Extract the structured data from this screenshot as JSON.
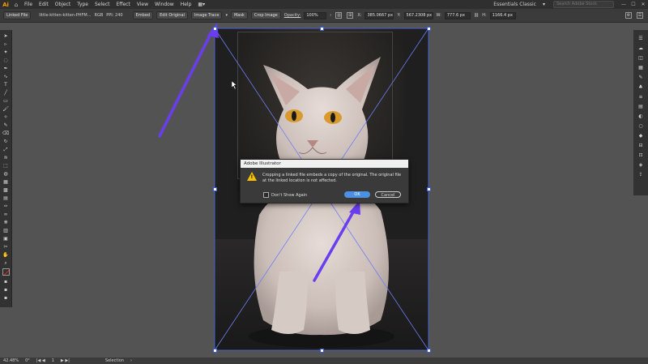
{
  "app": {
    "logo": "Ai",
    "workspace": "Essentials Classic",
    "search_placeholder": "Search Adobe Stock"
  },
  "menus": [
    "File",
    "Edit",
    "Object",
    "Type",
    "Select",
    "Effect",
    "View",
    "Window",
    "Help"
  ],
  "control_bar": {
    "linked_file": "Linked File",
    "file_name": "little-kitten-kitten-PHFM...",
    "color_mode": "RGB",
    "ppi": "PPI: 240",
    "embed": "Embed",
    "edit_original": "Edit Original",
    "image_trace": "Image Trace",
    "mask": "Mask",
    "crop_image": "Crop Image",
    "opacity_label": "Opacity:",
    "opacity_value": "100%",
    "x_label": "X:",
    "x_value": "385.0667 px",
    "y_label": "Y:",
    "y_value": "567.2308 px",
    "w_label": "W:",
    "w_value": "777.6 px",
    "h_label": "H:",
    "h_value": "1166.4 px"
  },
  "dialog": {
    "title": "Adobe Illustrator",
    "message": "Cropping a linked file embeds a copy of the original. The original file at the linked location is not affected.",
    "checkbox_label": "Don't Show Again",
    "ok_label": "OK",
    "cancel_label": "Cancel"
  },
  "status_bar": {
    "zoom": "42.48%",
    "angle": "0°",
    "page": "1",
    "tool": "Selection"
  },
  "colors": {
    "accent_arrow": "#6a3df0",
    "selection_blue": "#4a6cf7",
    "ok_button": "#4d8fe0"
  },
  "left_tools": [
    "selection-icon",
    "direct-selection-icon",
    "magic-wand-icon",
    "lasso-icon",
    "pen-icon",
    "curvature-icon",
    "type-icon",
    "line-icon",
    "rectangle-icon",
    "paintbrush-icon",
    "shaper-icon",
    "pencil-icon",
    "eraser-icon",
    "rotate-icon",
    "scale-icon",
    "width-icon",
    "free-transform-icon",
    "shape-builder-icon",
    "perspective-icon",
    "mesh-icon",
    "gradient-icon",
    "eyedropper-icon",
    "blend-icon",
    "symbol-sprayer-icon",
    "graph-icon",
    "artboard-icon",
    "slice-icon",
    "hand-icon",
    "zoom-icon"
  ],
  "right_panels": [
    "properties-icon",
    "libraries-icon",
    "layers-icon",
    "swatches-icon",
    "brushes-icon",
    "symbols-icon",
    "stroke-icon",
    "gradient-panel-icon",
    "transparency-icon",
    "appearance-icon",
    "graphic-styles-icon",
    "align-icon",
    "transform-icon",
    "pathfinder-icon",
    "export-icon"
  ]
}
